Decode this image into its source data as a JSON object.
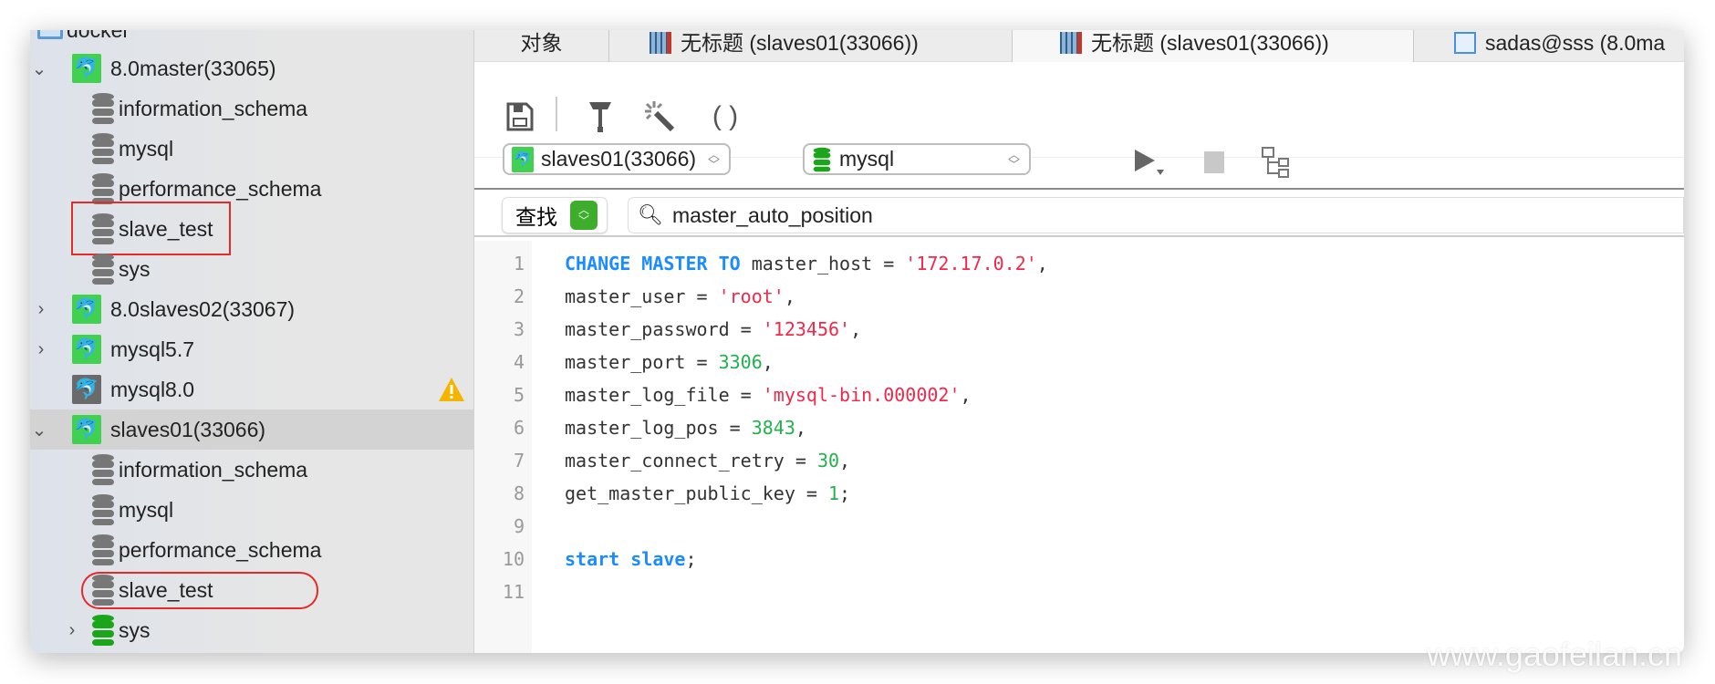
{
  "sidebar": {
    "root": "docker",
    "connections": [
      {
        "name": "8.0master(33065)",
        "expanded": true,
        "databases": [
          "information_schema",
          "mysql",
          "performance_schema",
          "slave_test",
          "sys"
        ]
      },
      {
        "name": "8.0slaves02(33067)",
        "expanded": false
      },
      {
        "name": "mysql5.7",
        "expanded": false
      },
      {
        "name": "mysql8.0",
        "expanded": false,
        "status": "warning-icon"
      },
      {
        "name": "slaves01(33066)",
        "expanded": true,
        "selected": true,
        "databases": [
          "information_schema",
          "mysql",
          "performance_schema",
          "slave_test",
          "sys"
        ]
      }
    ]
  },
  "tabs": [
    {
      "label": "对象"
    },
    {
      "label": "无标题 (slaves01(33066))"
    },
    {
      "label": "无标题 (slaves01(33066))",
      "active": true
    },
    {
      "label": "sadas@sss (8.0ma"
    }
  ],
  "toolbar": {
    "connection": "slaves01(33066)",
    "database": "mysql"
  },
  "find": {
    "label": "查找",
    "query": "master_auto_position"
  },
  "editor": {
    "lines": [
      "1",
      "2",
      "3",
      "4",
      "5",
      "6",
      "7",
      "8",
      "9",
      "10",
      "11"
    ],
    "code": {
      "l1a": "CHANGE MASTER TO",
      "l1b": " master_host = ",
      "l1c": "'172.17.0.2'",
      "l1d": ",",
      "l2a": "master_user = ",
      "l2b": "'root'",
      "l2c": ",",
      "l3a": "master_password = ",
      "l3b": "'123456'",
      "l3c": ",",
      "l4a": "master_port = ",
      "l4b": "3306",
      "l4c": ",",
      "l5a": "master_log_file = ",
      "l5b": "'mysql-bin.000002'",
      "l5c": ",",
      "l6a": "master_log_pos = ",
      "l6b": "3843",
      "l6c": ",",
      "l7a": "master_connect_retry = ",
      "l7b": "30",
      "l7c": ",",
      "l8a": "get_master_public_key = ",
      "l8b": "1",
      "l8c": ";",
      "l10a": "start slave",
      "l10b": ";"
    }
  },
  "watermark": "www.gaofeilan.cn",
  "colors": {
    "keyword": "#1a8cff",
    "string": "#f0284a",
    "number": "#22b24c",
    "highlight": "#e62a2a",
    "mysql_green": "#3fd14f"
  }
}
